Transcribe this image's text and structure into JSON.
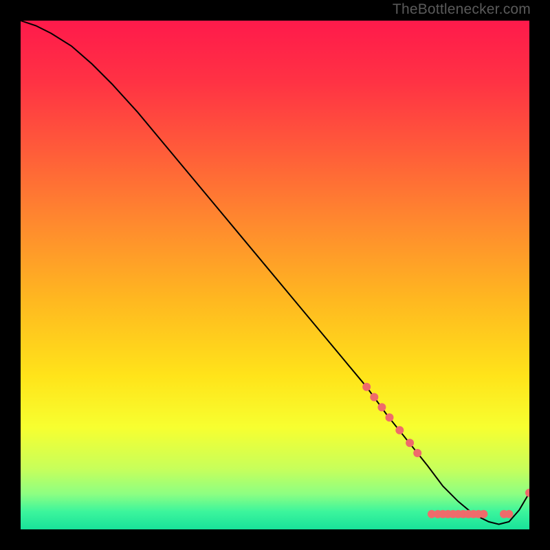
{
  "watermark": "TheBottlenecker.com",
  "chart_data": {
    "type": "line",
    "title": "",
    "xlabel": "",
    "ylabel": "",
    "xlim": [
      0,
      100
    ],
    "ylim": [
      0,
      100
    ],
    "grid": false,
    "legend": false,
    "background_gradient": {
      "stops": [
        {
          "pos": 0.0,
          "color": "#ff1a4b"
        },
        {
          "pos": 0.12,
          "color": "#ff3244"
        },
        {
          "pos": 0.25,
          "color": "#ff5a3a"
        },
        {
          "pos": 0.4,
          "color": "#ff8a2e"
        },
        {
          "pos": 0.55,
          "color": "#ffb820"
        },
        {
          "pos": 0.7,
          "color": "#ffe41a"
        },
        {
          "pos": 0.8,
          "color": "#f7ff30"
        },
        {
          "pos": 0.88,
          "color": "#c8ff5a"
        },
        {
          "pos": 0.93,
          "color": "#8eff82"
        },
        {
          "pos": 0.965,
          "color": "#3cf59c"
        },
        {
          "pos": 1.0,
          "color": "#18e29a"
        }
      ]
    },
    "series": [
      {
        "name": "bottleneck-curve",
        "color": "#000000",
        "x": [
          0,
          3,
          6,
          10,
          14,
          18,
          23,
          28,
          33,
          38,
          43,
          48,
          53,
          58,
          63,
          68,
          72,
          76,
          80,
          83,
          86,
          89,
          92,
          94,
          96,
          98,
          100
        ],
        "y": [
          100,
          99,
          97.5,
          95,
          91.5,
          87.5,
          82,
          76,
          70,
          64,
          58,
          52,
          46,
          40,
          34,
          28,
          22.5,
          17.5,
          12.5,
          8.5,
          5.5,
          3,
          1.5,
          1,
          1.5,
          3.8,
          7.2
        ]
      }
    ],
    "marker_points": {
      "name": "highlight-dots",
      "color": "#ef6b6b",
      "radius": 6,
      "points": [
        {
          "x": 68.0,
          "y": 28.0
        },
        {
          "x": 69.5,
          "y": 26.0
        },
        {
          "x": 71.0,
          "y": 24.0
        },
        {
          "x": 72.5,
          "y": 22.0
        },
        {
          "x": 74.5,
          "y": 19.5
        },
        {
          "x": 76.5,
          "y": 17.0
        },
        {
          "x": 78.0,
          "y": 15.0
        },
        {
          "x": 80.8,
          "y": 3.0
        },
        {
          "x": 82.0,
          "y": 3.0
        },
        {
          "x": 83.0,
          "y": 3.0
        },
        {
          "x": 84.0,
          "y": 3.0
        },
        {
          "x": 85.0,
          "y": 3.0
        },
        {
          "x": 86.0,
          "y": 3.0
        },
        {
          "x": 87.0,
          "y": 3.0
        },
        {
          "x": 88.0,
          "y": 3.0
        },
        {
          "x": 89.0,
          "y": 3.0
        },
        {
          "x": 90.0,
          "y": 3.0
        },
        {
          "x": 91.0,
          "y": 3.0
        },
        {
          "x": 95.0,
          "y": 3.0
        },
        {
          "x": 96.0,
          "y": 3.0
        },
        {
          "x": 100.0,
          "y": 7.2
        }
      ]
    }
  }
}
